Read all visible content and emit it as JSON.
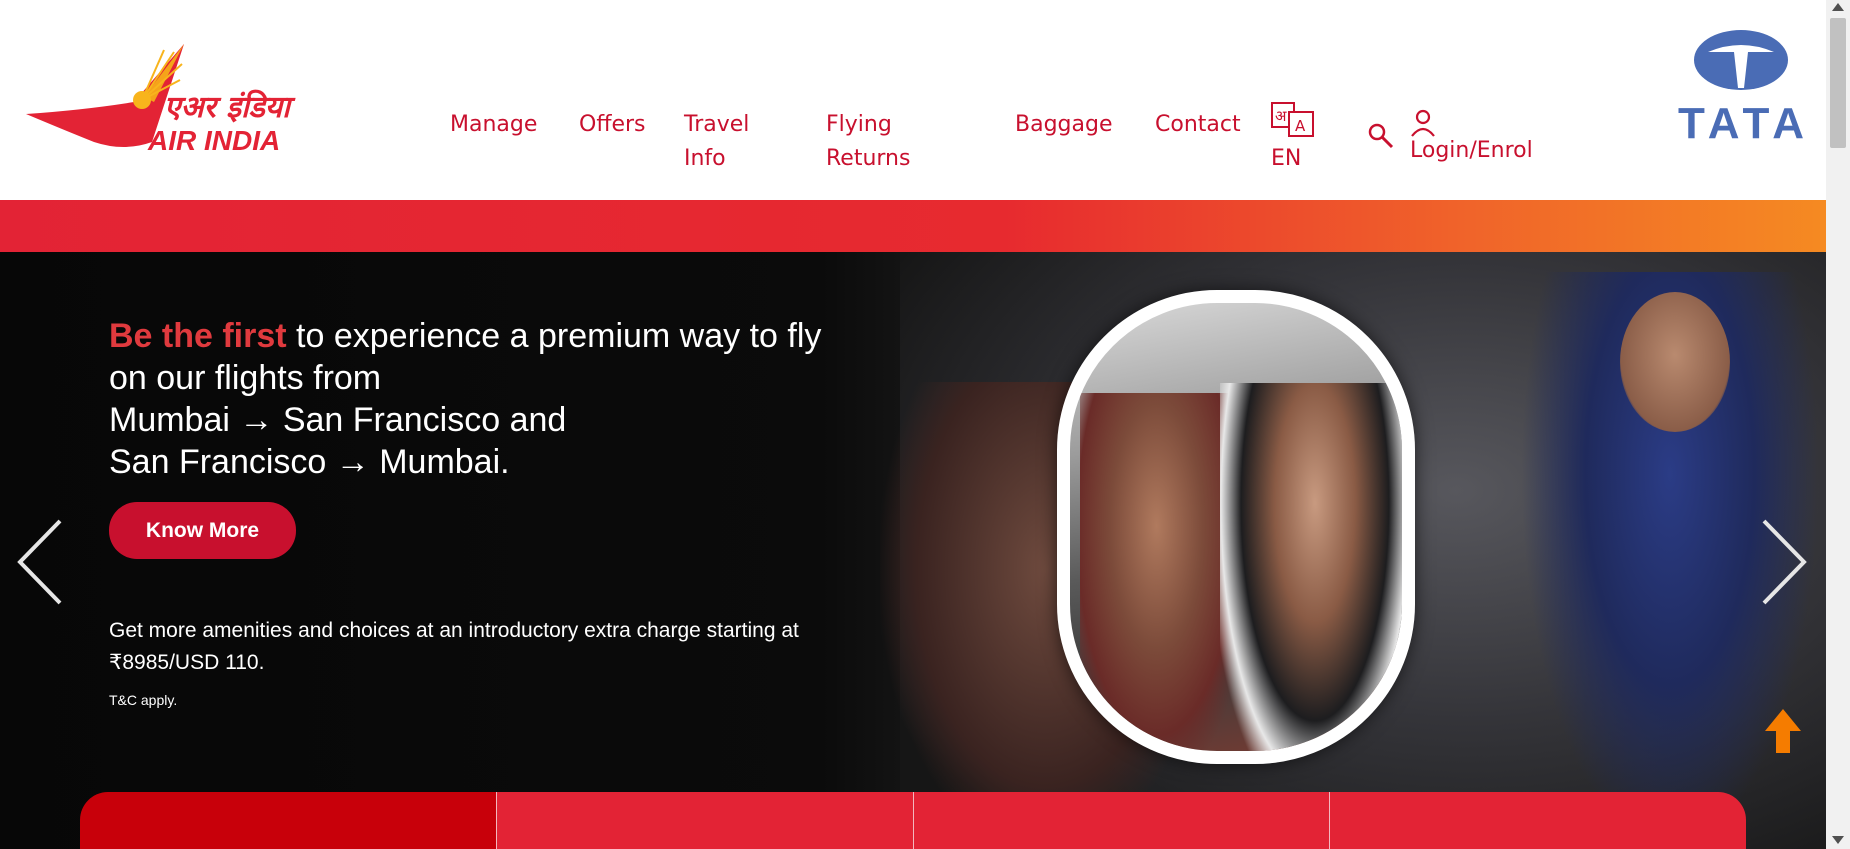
{
  "header": {
    "logo": {
      "hindi_text": "एअर इंडिया",
      "english_text": "AIR INDIA"
    },
    "nav": [
      {
        "label_line1": "Manage",
        "label_line2": ""
      },
      {
        "label_line1": "Offers",
        "label_line2": ""
      },
      {
        "label_line1": "Travel",
        "label_line2": "Info"
      },
      {
        "label_line1": "Flying",
        "label_line2": "Returns"
      },
      {
        "label_line1": "Baggage",
        "label_line2": ""
      },
      {
        "label_line1": "Contact",
        "label_line2": ""
      }
    ],
    "language": {
      "label": "EN",
      "icon": "language-icon"
    },
    "search_icon": "search-icon",
    "login": {
      "label": "Login/Enrol",
      "icon": "user-icon"
    },
    "partner_logo": {
      "text": "TATA"
    }
  },
  "hero": {
    "headline_highlight": "Be the first",
    "headline_line1_rest": " to experience a premium way to fly",
    "headline_line2": "on our flights from",
    "headline_line3": "Mumbai → San Francisco and",
    "headline_line4": "San Francisco → Mumbai.",
    "cta_label": "Know More",
    "amenities_line1": "Get more amenities and choices at an introductory extra charge starting at",
    "amenities_line2": "₹8985/USD 110.",
    "terms": "T&C apply."
  },
  "colors": {
    "brand_red": "#c8102e",
    "highlight_red": "#e03a3e",
    "gradient_start": "#e32335",
    "gradient_end": "#f58a22",
    "tata_blue": "#4a6cb5",
    "to_top_orange": "#f57c00"
  }
}
